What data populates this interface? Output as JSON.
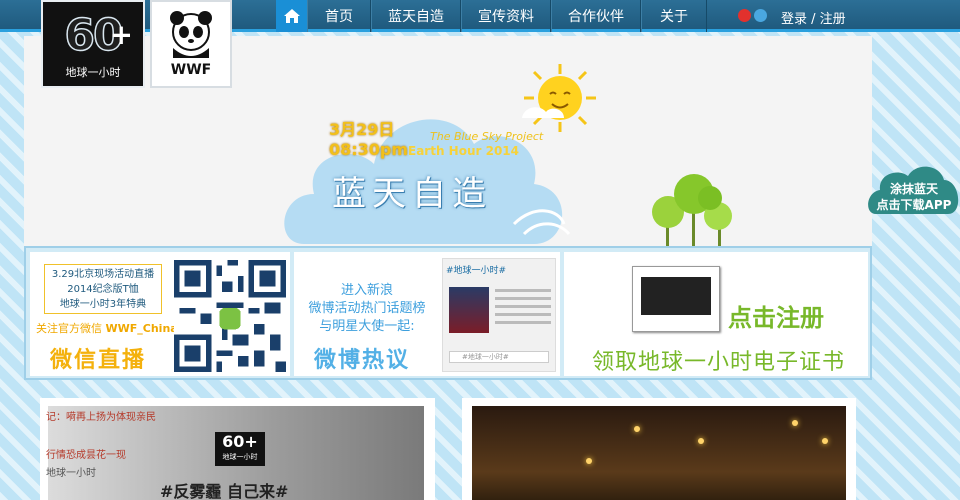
{
  "nav": {
    "items": [
      "首页",
      "蓝天自造",
      "宣传资料",
      "合作伙伴",
      "关于"
    ],
    "login": "登录 / 注册"
  },
  "logos": {
    "earth_hour": {
      "number": "60",
      "plus": "+",
      "sub": "地球一小时"
    },
    "wwf": "WWF"
  },
  "hero": {
    "date": "3月29日",
    "time": "08:30pm",
    "project": "The Blue Sky Project",
    "event": "Earth Hour 2014",
    "title": "蓝天自造"
  },
  "side_badge": {
    "line1": "涂抹蓝天",
    "line2": "点击下载APP"
  },
  "strip": {
    "wechat": {
      "box_lines": [
        "3.29北京现场活动直播",
        "2014纪念版T恤",
        "地球一小时3年特典"
      ],
      "follow_prefix": "关注官方微信",
      "follow_id": "WWF_China",
      "big": "微信直播"
    },
    "weibo": {
      "lines": [
        "进入新浪",
        "微博活动热门话题榜",
        "与明星大使一起:"
      ],
      "big": "微博热议",
      "card_title": "#地球一小时#",
      "input_placeholder": "#地球一小时#"
    },
    "cert": {
      "register": "点击注册",
      "text": "领取地球一小时电子证书"
    }
  },
  "cards": {
    "left": {
      "news": [
        "记：嗬再上扬为体现亲民",
        "行情恐成昙花一现",
        "地球一小时"
      ],
      "badge_number": "60+",
      "badge_sub": "地球一小时",
      "slogan": "#反雾霾 自己来#"
    }
  }
}
